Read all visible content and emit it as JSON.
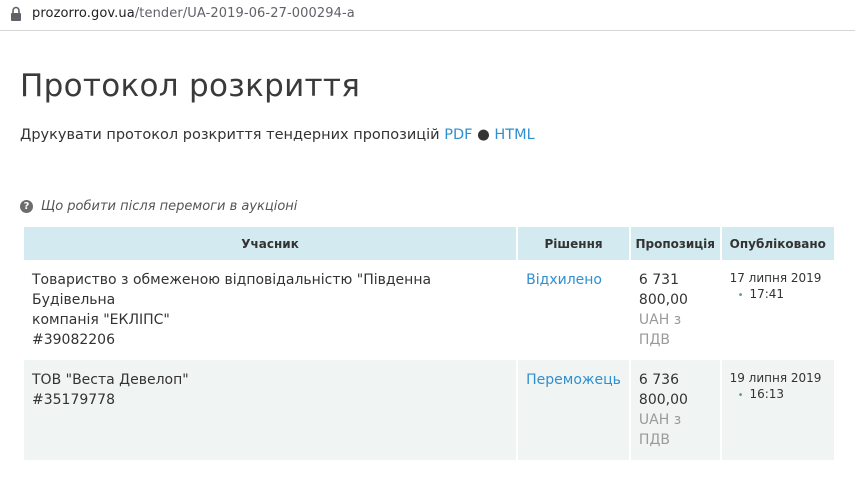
{
  "browser": {
    "url_host": "prozorro.gov.ua",
    "url_path": "/tender/UA-2019-06-27-000294-a"
  },
  "page": {
    "title": "Протокол розкриття",
    "print_text": "Друкувати протокол розкриття тендерних пропозицій",
    "pdf_link": "PDF",
    "separator": "●",
    "html_link": "HTML",
    "help_link": "Що робити після перемоги в аукціоні"
  },
  "table": {
    "headers": {
      "participant": "Учасник",
      "decision": "Рішення",
      "bid": "Пропозиція",
      "published": "Опубліковано"
    },
    "rows": [
      {
        "name_line1": "Товариство з обмеженою відповідальністю \"Південна Будівельна",
        "name_line2": "компанія \"ЕКЛІПС\"",
        "code": "#39082206",
        "decision": "Відхилено",
        "amount_line1": "6 731",
        "amount_line2": "800,00",
        "currency_line1": "UAH з",
        "currency_line2": "ПДВ",
        "date": "17 липня 2019",
        "time": "17:41"
      },
      {
        "name_line1": "ТОВ \"Веста Девелоп\"",
        "name_line2": "",
        "code": "#35179778",
        "decision": "Переможець",
        "amount_line1": "6 736",
        "amount_line2": "800,00",
        "currency_line1": "UAH з",
        "currency_line2": "ПДВ",
        "date": "19 липня 2019",
        "time": "16:13"
      }
    ]
  },
  "colors": {
    "link": "#2f8fcf",
    "header_bg": "#d3eaf1",
    "row_alt_bg": "#f0f4f2"
  },
  "icons": {
    "lock": "lock-icon",
    "help": "question-circle-icon"
  }
}
